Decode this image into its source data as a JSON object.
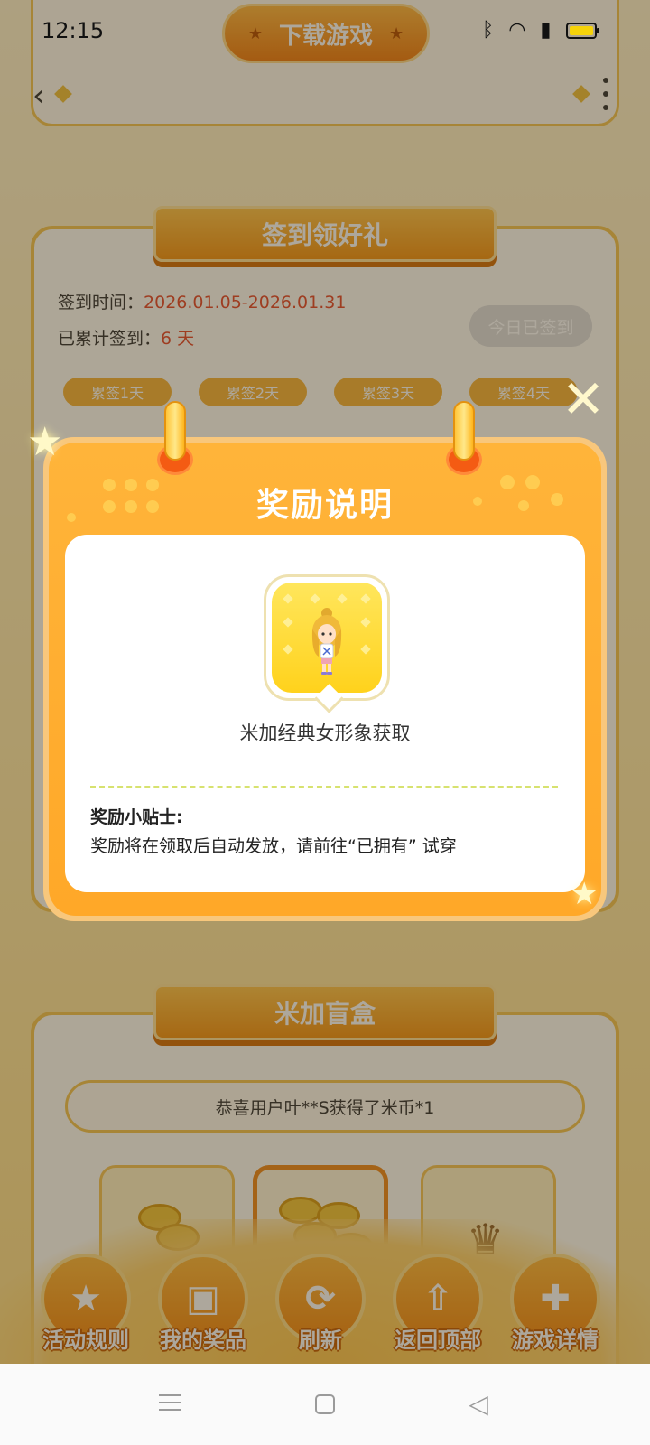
{
  "status_bar": {
    "time": "12:15",
    "icons": [
      "bluetooth-icon",
      "wifi-icon",
      "signal-icon",
      "battery-icon"
    ]
  },
  "header": {
    "download_label": "下载游戏"
  },
  "checkin": {
    "title": "签到领好礼",
    "time_label": "签到时间：",
    "time_value": "2026.01.05-2026.01.31",
    "total_label": "已累计签到：",
    "total_value": "6 天",
    "signed_button": "今日已签到",
    "day_tags": [
      "累签1天",
      "累签2天",
      "累签3天",
      "累签4天"
    ]
  },
  "blind_box": {
    "title": "米加盲盒",
    "marquee": "恭喜用户叶**S获得了米币*1"
  },
  "bottom_nav": [
    {
      "label": "活动规则",
      "icon": "rules-icon",
      "glyph": "★"
    },
    {
      "label": "我的奖品",
      "icon": "gift-icon",
      "glyph": "▣"
    },
    {
      "label": "刷新",
      "icon": "refresh-icon",
      "glyph": "⟳"
    },
    {
      "label": "返回顶部",
      "icon": "back-to-top-icon",
      "glyph": "⇧"
    },
    {
      "label": "游戏详情",
      "icon": "gamepad-icon",
      "glyph": "✚"
    }
  ],
  "modal": {
    "title": "奖励说明",
    "reward_name": "米加经典女形象获取",
    "tip_title": "奖励小贴士:",
    "tip_text": "奖励将在领取后自动发放，请前往“已拥有” 试穿"
  },
  "colors": {
    "accent": "#ffa828",
    "brand_orange": "#f08a1c",
    "highlight_red": "#e5492c"
  }
}
